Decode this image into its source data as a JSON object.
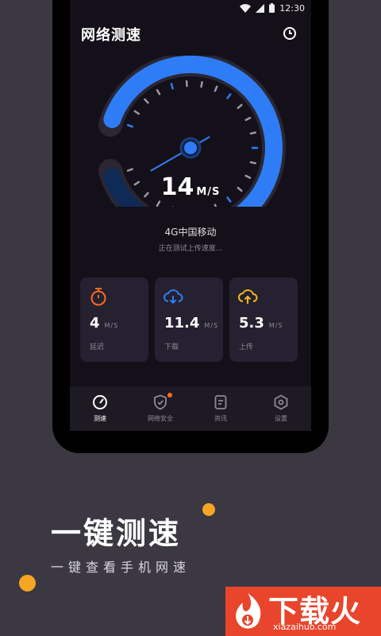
{
  "status_bar": {
    "time": "12:30"
  },
  "header": {
    "title": "网络测速",
    "history_icon": "clock-icon"
  },
  "gauge": {
    "speed_value": "14",
    "speed_unit": "M/S",
    "progress": 0.78,
    "accent": "#2f7df6"
  },
  "network": {
    "carrier": "4G中国移动",
    "status": "正在测试上传速度..."
  },
  "cards": [
    {
      "value": "4",
      "unit": "M/S",
      "label": "延迟",
      "icon": "timer-icon",
      "color": "#ff6a1a"
    },
    {
      "value": "11.4",
      "unit": "M/S",
      "label": "下载",
      "icon": "cloud-download-icon",
      "color": "#2f7df6"
    },
    {
      "value": "5.3",
      "unit": "M/S",
      "label": "上传",
      "icon": "cloud-upload-icon",
      "color": "#f5b81c"
    }
  ],
  "tabs": [
    {
      "label": "测速",
      "icon": "speedometer-icon",
      "active": true
    },
    {
      "label": "网络安全",
      "icon": "shield-check-icon",
      "badge": true
    },
    {
      "label": "资讯",
      "icon": "document-icon"
    },
    {
      "label": "设置",
      "icon": "settings-hex-icon"
    }
  ],
  "promo": {
    "headline": "一键测速",
    "subline": "一键查看手机网速"
  },
  "watermark": {
    "brand": "下载火",
    "url": "xiazaihuo.com"
  }
}
